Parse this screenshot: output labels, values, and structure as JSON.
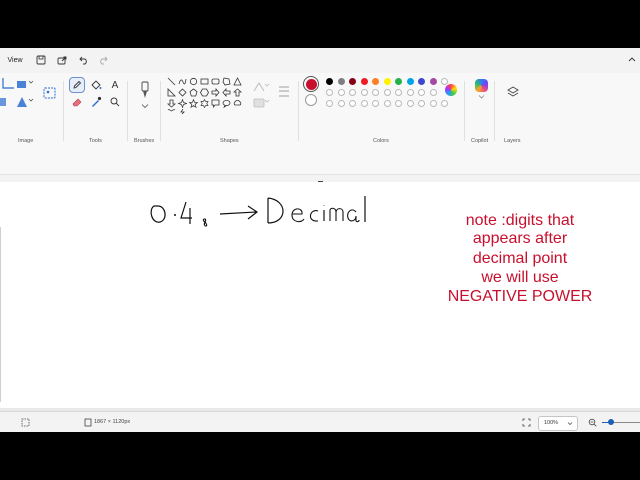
{
  "menu": {
    "view_label": "View"
  },
  "ribbon": {
    "groups": {
      "image": "Image",
      "tools": "Tools",
      "brushes": "Brushes",
      "shapes": "Shapes",
      "colors": "Colors",
      "copilot": "Copilot",
      "layers": "Layers"
    },
    "palette_row1": [
      "#000000",
      "#7f7f7f",
      "#880015",
      "#ed1c24",
      "#ff7f27",
      "#fff200",
      "#22b14c",
      "#00a2e8",
      "#3f48cc",
      "#a349a4"
    ],
    "palette_row2": [
      "#ffffff",
      "#c3c3c3",
      "#b97a57",
      "#ffaec9",
      "#ffc90e",
      "#efe4b0",
      "#b5e61d",
      "#99d9ea",
      "#7092be",
      "#c8bfe7"
    ],
    "selected_color": "#c8102e"
  },
  "canvas": {
    "handwriting": {
      "digit_zero": "0",
      "dot": ".",
      "digit_four": "4",
      "base_subscript": "8",
      "word": "Decimal"
    },
    "note": {
      "line1": "note :digits that",
      "line2": "appears after",
      "line3": "decimal point",
      "line4": "we will use",
      "line5": "NEGATIVE POWER",
      "color": "#c8102e"
    }
  },
  "status": {
    "dimensions": "1867 × 1120px",
    "zoom": "100%"
  }
}
